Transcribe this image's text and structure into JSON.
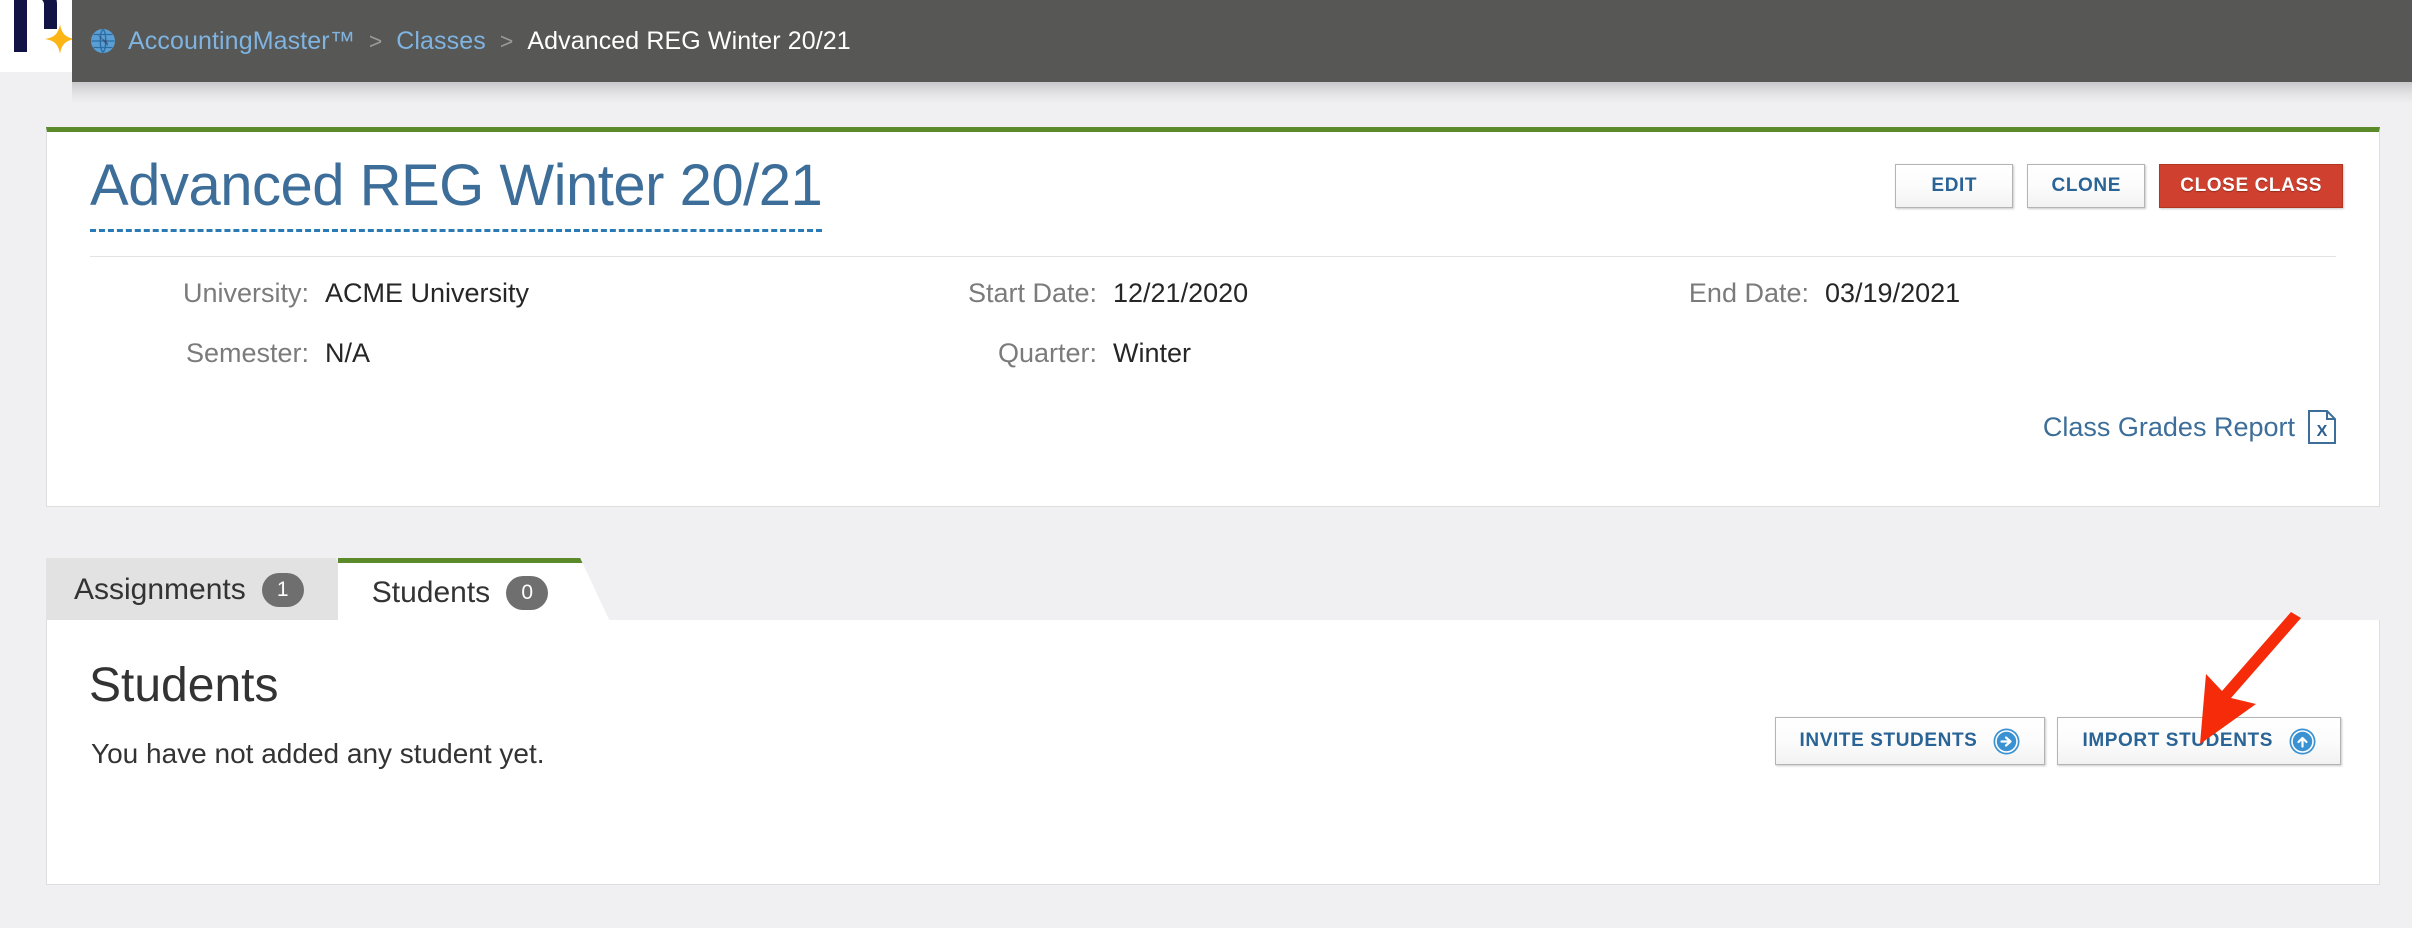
{
  "breadcrumb": {
    "globe_icon": "globe-icon",
    "items": [
      {
        "label": "AccountingMaster™",
        "current": false
      },
      {
        "label": "Classes",
        "current": false
      },
      {
        "label": "Advanced REG Winter 20/21",
        "current": true
      }
    ],
    "separator": ">"
  },
  "logo": {
    "star_icon": "star-icon",
    "mark": "r"
  },
  "class": {
    "title": "Advanced REG Winter 20/21",
    "actions": {
      "edit": "EDIT",
      "clone": "CLONE",
      "close_class": "CLOSE CLASS"
    },
    "meta": {
      "university_label": "University:",
      "university_value": "ACME University",
      "semester_label": "Semester:",
      "semester_value": "N/A",
      "start_date_label": "Start Date:",
      "start_date_value": "12/21/2020",
      "quarter_label": "Quarter:",
      "quarter_value": "Winter",
      "end_date_label": "End Date:",
      "end_date_value": "03/19/2021"
    },
    "report_link": "Class Grades Report",
    "report_icon": "excel-file-icon"
  },
  "tabs": [
    {
      "label": "Assignments",
      "badge": "1",
      "active": false
    },
    {
      "label": "Students",
      "badge": "0",
      "active": true
    }
  ],
  "students": {
    "heading": "Students",
    "empty_message": "You have not added any student yet.",
    "invite_label": "INVITE STUDENTS",
    "invite_icon": "circle-arrow-right-icon",
    "import_label": "IMPORT STUDENTS",
    "import_icon": "circle-arrow-up-icon"
  },
  "annotation": {
    "arrow_icon": "red-arrow-pointing-down-left"
  },
  "colors": {
    "topbar": "#575755",
    "accent_green": "#5b8a2b",
    "title_blue": "#3d6e99",
    "link_blue": "#2a6496",
    "danger_red": "#d0402f",
    "badge_gray": "#6f6f6f",
    "annotation_red": "#f52b0a",
    "page_bg": "#f0f0f2"
  }
}
